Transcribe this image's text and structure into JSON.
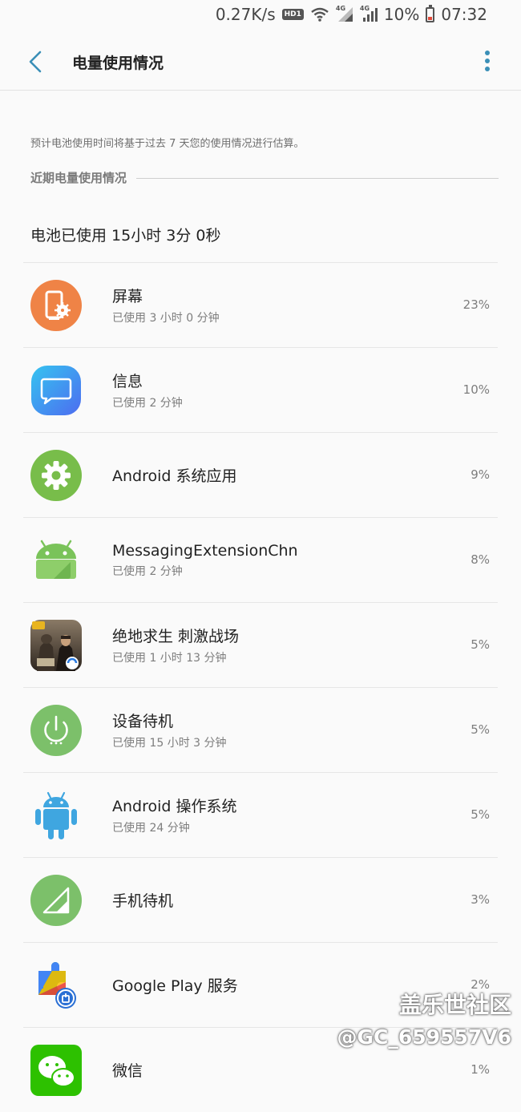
{
  "status_bar": {
    "net_speed": "0.27K/s",
    "hd_badge": "HD1",
    "network1": "4G",
    "network2": "4G",
    "battery": "10%",
    "time": "07:32"
  },
  "app_bar": {
    "title": "电量使用情况",
    "accent_color": "#3a8fb7"
  },
  "summary": {
    "estimate_note": "预计电池使用时间将基于过去 7 天您的使用情况进行估算。",
    "section_title": "近期电量使用情况",
    "battery_used": "电池已使用 15小时 3分 0秒"
  },
  "apps": [
    {
      "name": "屏幕",
      "usage": "已使用 3 小时 0 分钟",
      "percent": "23%",
      "icon": "screen-icon",
      "color": "#ef8346"
    },
    {
      "name": "信息",
      "usage": "已使用 2 分钟",
      "percent": "10%",
      "icon": "messages-icon",
      "color": "#3e8ef0"
    },
    {
      "name": "Android 系统应用",
      "usage": "",
      "percent": "9%",
      "icon": "gear-icon",
      "color": "#78bd4a"
    },
    {
      "name": "MessagingExtensionChn",
      "usage": "已使用 2 分钟",
      "percent": "8%",
      "icon": "android-icon",
      "color": "#7ac35a"
    },
    {
      "name": "绝地求生 刺激战场",
      "usage": "已使用 1 小时 13 分钟",
      "percent": "5%",
      "icon": "pubg-icon",
      "color": "#5a4a3a"
    },
    {
      "name": "设备待机",
      "usage": "已使用 15 小时 3 分钟",
      "percent": "5%",
      "icon": "power-icon",
      "color": "#7cc06a"
    },
    {
      "name": "Android 操作系统",
      "usage": "已使用 24 分钟",
      "percent": "5%",
      "icon": "android-os-icon",
      "color": "#3fa6e0"
    },
    {
      "name": "手机待机",
      "usage": "",
      "percent": "3%",
      "icon": "signal-icon",
      "color": "#7cc06a"
    },
    {
      "name": "Google Play 服务",
      "usage": "",
      "percent": "2%",
      "icon": "play-services-icon",
      "color": "#4285f4"
    },
    {
      "name": "微信",
      "usage": "",
      "percent": "1%",
      "icon": "wechat-icon",
      "color": "#2dc100"
    }
  ],
  "watermark": {
    "brand": "盖乐世社区",
    "user": "@GC_659557V6"
  }
}
